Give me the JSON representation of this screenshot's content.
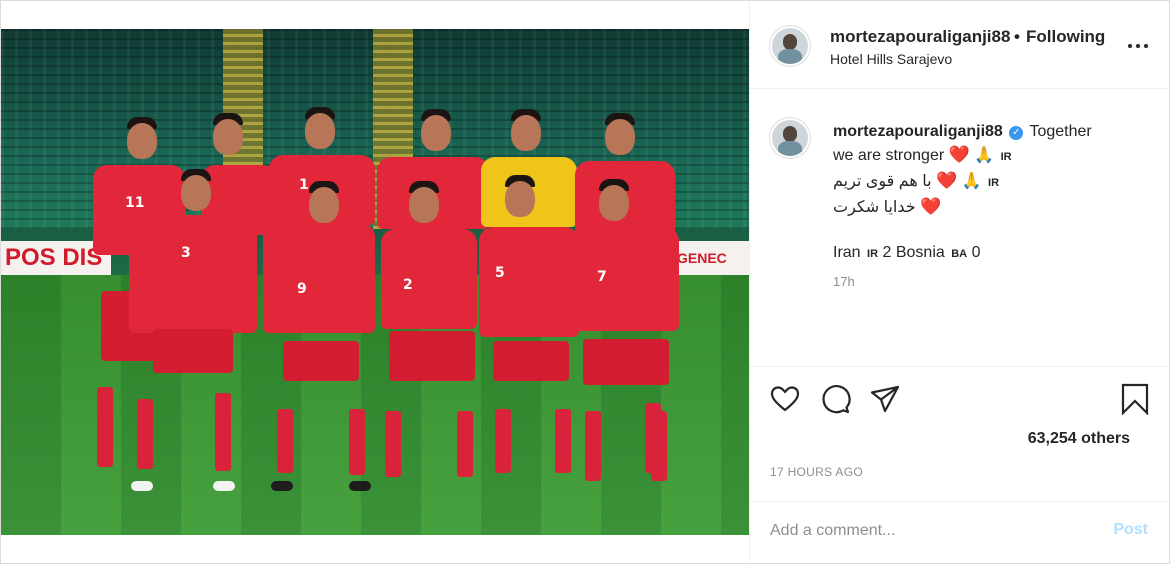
{
  "header": {
    "username": "mortezapouraliganji88",
    "separator": "•",
    "follow_status": "Following",
    "location": "Hotel Hills Sarajevo",
    "more_icon": "more-horizontal-icon"
  },
  "photo": {
    "board_text": "POS DIS",
    "board_text_right": "GENEC",
    "jersey_numbers": [
      "11",
      "1",
      "3",
      "9",
      "2",
      "5",
      "7"
    ]
  },
  "caption": {
    "username": "mortezapouraliganji88",
    "verified_icon": "verified-badge-icon",
    "line1_text": "Together",
    "line2_text": "we are stronger",
    "heart": "❤️",
    "pray": "🙏",
    "flag_ir": "IR",
    "line3_text": "با هم قوی تریم",
    "line4_text": "خدایا شکرت",
    "score_team1": "Iran",
    "score_flag1": "IR",
    "score_val1": "2",
    "score_team2": "Bosnia",
    "score_flag2": "BA",
    "score_val2": "0",
    "time": "17h"
  },
  "actions": {
    "likes": "63,254 others",
    "timestamp": "17 HOURS AGO"
  },
  "comment": {
    "placeholder": "Add a comment...",
    "post_label": "Post"
  },
  "colors": {
    "text": "#262626",
    "muted": "#8e8e8e",
    "border": "#dbdbdb",
    "verified": "#3897f0",
    "post_disabled": "#b2dffc"
  }
}
